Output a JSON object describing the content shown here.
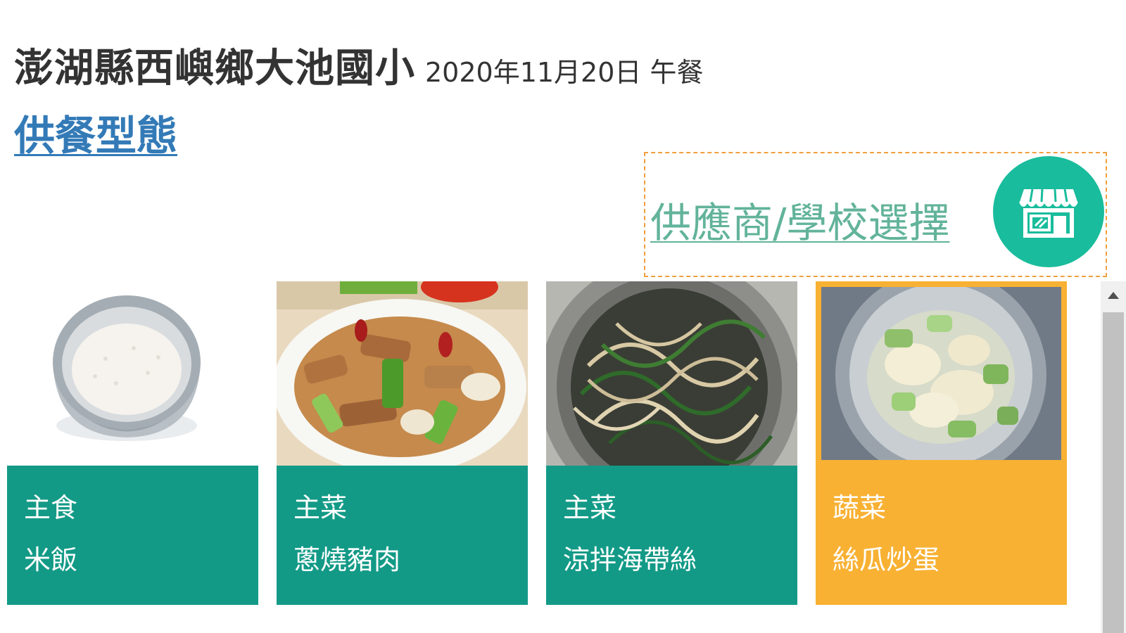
{
  "header": {
    "school_name": "澎湖縣西嶼鄉大池國小",
    "meal_date": "2020年11月20日 午餐"
  },
  "meal_type_link": "供餐型態",
  "supplier": {
    "link_label": "供應商/學校選擇",
    "button_icon": "store-icon"
  },
  "colors": {
    "card_green": "#139a87",
    "card_highlight": "#f8b133",
    "link_blue": "#337ab7",
    "supplier_green": "#62b39a",
    "store_button": "#19bc9c",
    "dashed_border": "#f0a040"
  },
  "dishes": [
    {
      "category": "主食",
      "name": "米飯",
      "image": "rice-bowl-photo",
      "highlighted": false
    },
    {
      "category": "主菜",
      "name": "蔥燒豬肉",
      "image": "scallion-pork-photo",
      "highlighted": false
    },
    {
      "category": "主菜",
      "name": "涼拌海帶絲",
      "image": "seaweed-salad-photo",
      "highlighted": false
    },
    {
      "category": "蔬菜",
      "name": "絲瓜炒蛋",
      "image": "loofah-egg-photo",
      "highlighted": true
    }
  ],
  "scrollbar": {
    "icon": "scroll-up-arrow-icon"
  }
}
